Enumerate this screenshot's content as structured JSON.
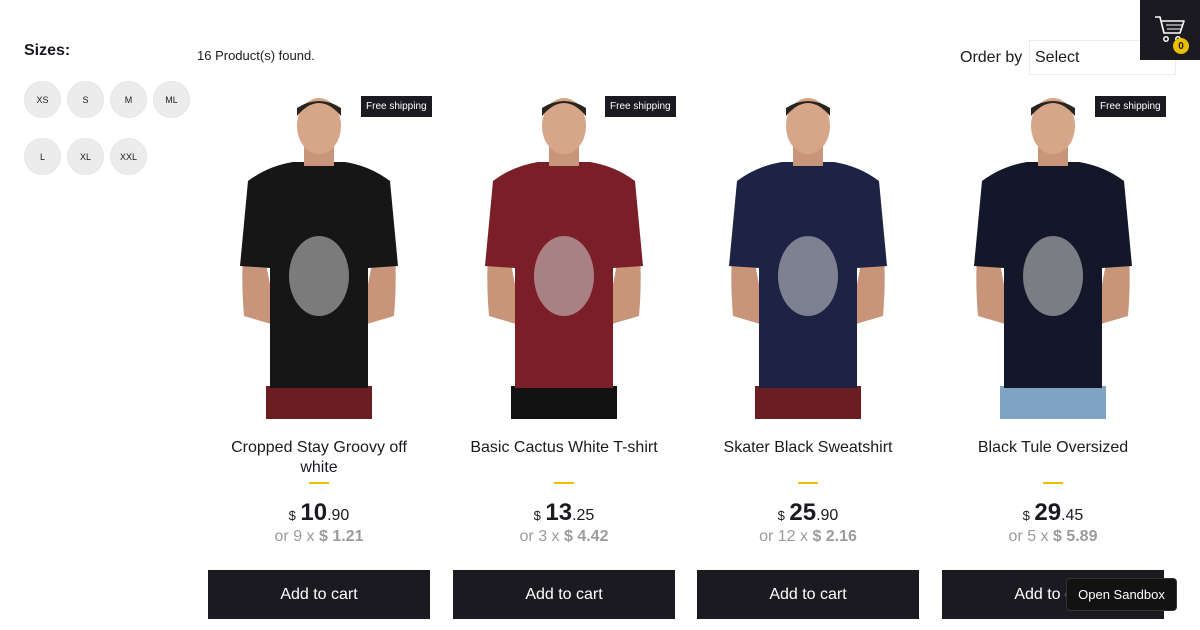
{
  "filters": {
    "title": "Sizes:",
    "sizes": [
      "XS",
      "S",
      "M",
      "ML",
      "L",
      "XL",
      "XXL"
    ]
  },
  "results": {
    "found_text": "16 Product(s) found."
  },
  "order": {
    "label": "Order by",
    "selected": "Select"
  },
  "cart": {
    "icon": "cart-icon",
    "count": "0"
  },
  "products": [
    {
      "title": "Cropped Stay Groovy off white",
      "badge": "Free shipping",
      "currency": "$",
      "price_int": "10",
      "price_dec": ".90",
      "installments": "or 9 x",
      "installment_value": "$ 1.21",
      "add_label": "Add to cart",
      "shirt_color": "#161616",
      "pants_color": "#6b1e22"
    },
    {
      "title": "Basic Cactus White T-shirt",
      "badge": "Free shipping",
      "currency": "$",
      "price_int": "13",
      "price_dec": ".25",
      "installments": "or 3 x",
      "installment_value": "$ 4.42",
      "add_label": "Add to cart",
      "shirt_color": "#7a1f27",
      "pants_color": "#111111"
    },
    {
      "title": "Skater Black Sweatshirt",
      "badge": "",
      "currency": "$",
      "price_int": "25",
      "price_dec": ".90",
      "installments": "or 12 x",
      "installment_value": "$ 2.16",
      "add_label": "Add to cart",
      "shirt_color": "#1c2344",
      "pants_color": "#6b1e22"
    },
    {
      "title": "Black Tule Oversized",
      "badge": "Free shipping",
      "currency": "$",
      "price_int": "29",
      "price_dec": ".45",
      "installments": "or 5 x",
      "installment_value": "$ 5.89",
      "add_label": "Add to cart",
      "shirt_color": "#141729",
      "pants_color": "#7fa3c3"
    }
  ],
  "sandbox": {
    "label": "Open Sandbox"
  },
  "colors": {
    "accent": "#eabf00",
    "dark": "#1b1a20",
    "muted": "#9c9b9b"
  }
}
